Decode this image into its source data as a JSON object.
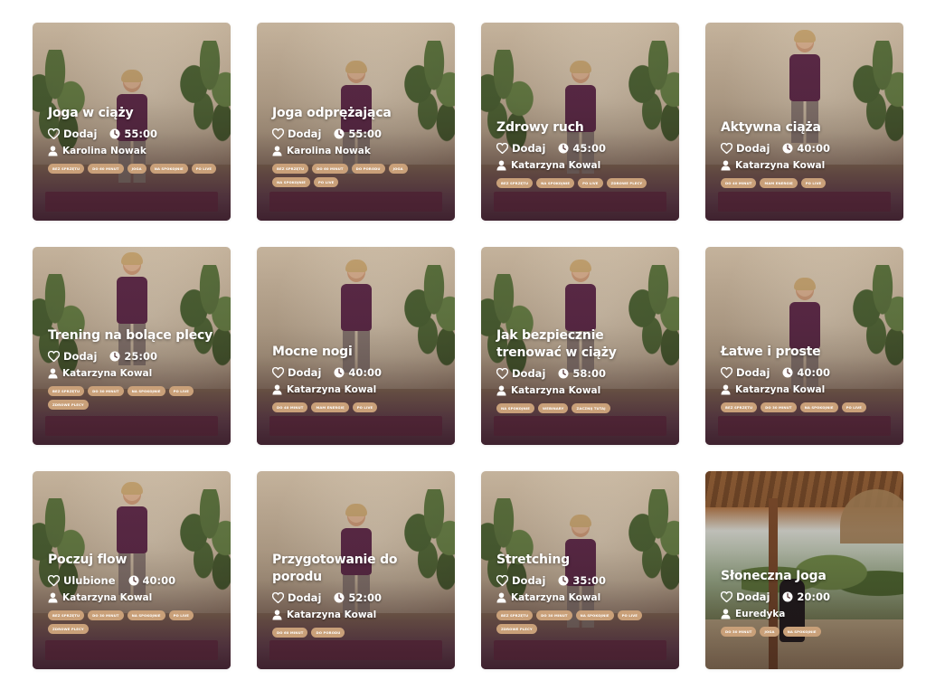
{
  "cards": [
    {
      "title": "Joga w ciąży",
      "fav_label": "Dodaj",
      "duration": "55:00",
      "author": "Karolina Nowak",
      "tags": [
        "BEZ SPRZĘTU",
        "DO 60 MINUT",
        "JOGA",
        "NA SPOKOJNIE",
        "PO LIVE"
      ]
    },
    {
      "title": "Joga odprężająca",
      "fav_label": "Dodaj",
      "duration": "55:00",
      "author": "Karolina Nowak",
      "tags": [
        "BEZ SPRZĘTU",
        "DO 60 MINUT",
        "DO PORODU",
        "JOGA",
        "NA SPOKOJNIE",
        "PO LIVE"
      ]
    },
    {
      "title": "Zdrowy ruch",
      "fav_label": "Dodaj",
      "duration": "45:00",
      "author": "Katarzyna Kowal",
      "tags": [
        "BEZ SPRZĘTU",
        "NA SPOKOJNIE",
        "PO LIVE",
        "ZDROWE PLECY"
      ]
    },
    {
      "title": "Aktywna ciąża",
      "fav_label": "Dodaj",
      "duration": "40:00",
      "author": "Katarzyna Kowal",
      "tags": [
        "DO 40 MINUT",
        "MAM ENERGIĘ",
        "PO LIVE"
      ]
    },
    {
      "title": "Trening na bolące plecy",
      "fav_label": "Dodaj",
      "duration": "25:00",
      "author": "Katarzyna Kowal",
      "tags": [
        "BEZ SPRZĘTU",
        "DO 30 MINUT",
        "NA SPOKOJNIE",
        "PO LIVE",
        "ZDROWE PLECY"
      ]
    },
    {
      "title": "Mocne nogi",
      "fav_label": "Dodaj",
      "duration": "40:00",
      "author": "Katarzyna Kowal",
      "tags": [
        "DO 40 MINUT",
        "MAM ENERGIĘ",
        "PO LIVE"
      ]
    },
    {
      "title": "Jak bezpiecznie trenować w ciąży",
      "fav_label": "Dodaj",
      "duration": "58:00",
      "author": "Katarzyna Kowal",
      "tags": [
        "NA SPOKOJNIE",
        "WEBINARY",
        "ZACZNIJ TUTAJ"
      ]
    },
    {
      "title": "Łatwe i proste",
      "fav_label": "Dodaj",
      "duration": "40:00",
      "author": "Katarzyna Kowal",
      "tags": [
        "BEZ SPRZĘTU",
        "DO 30 MINUT",
        "NA SPOKOJNIE",
        "PO LIVE"
      ]
    },
    {
      "title": "Poczuj flow",
      "fav_label": "Ulubione",
      "duration": "40:00",
      "author": "Katarzyna Kowal",
      "tags": [
        "BEZ SPRZĘTU",
        "DO 30 MINUT",
        "NA SPOKOJNIE",
        "PO LIVE",
        "ZDROWE PLECY"
      ]
    },
    {
      "title": "Przygotowanie do porodu",
      "fav_label": "Dodaj",
      "duration": "52:00",
      "author": "Katarzyna Kowal",
      "tags": [
        "DO 60 MINUT",
        "DO PORODU"
      ]
    },
    {
      "title": "Stretching",
      "fav_label": "Dodaj",
      "duration": "35:00",
      "author": "Katarzyna Kowal",
      "tags": [
        "BEZ SPRZĘTU",
        "DO 30 MINUT",
        "NA SPOKOJNIE",
        "PO LIVE",
        "ZDROWE PLECY"
      ]
    },
    {
      "title": "Słoneczna Joga",
      "fav_label": "Dodaj",
      "duration": "20:00",
      "author": "Euredyka",
      "tags": [
        "DO 30 MINUT",
        "JOGA",
        "NA SPOKOJNIE"
      ]
    }
  ],
  "icons": {
    "favorite": "heart-icon",
    "duration": "clock-icon",
    "author": "user-icon"
  },
  "colors": {
    "tag_background": "#c9a079",
    "text": "#ffffff",
    "outfit": "#5e2a49"
  }
}
